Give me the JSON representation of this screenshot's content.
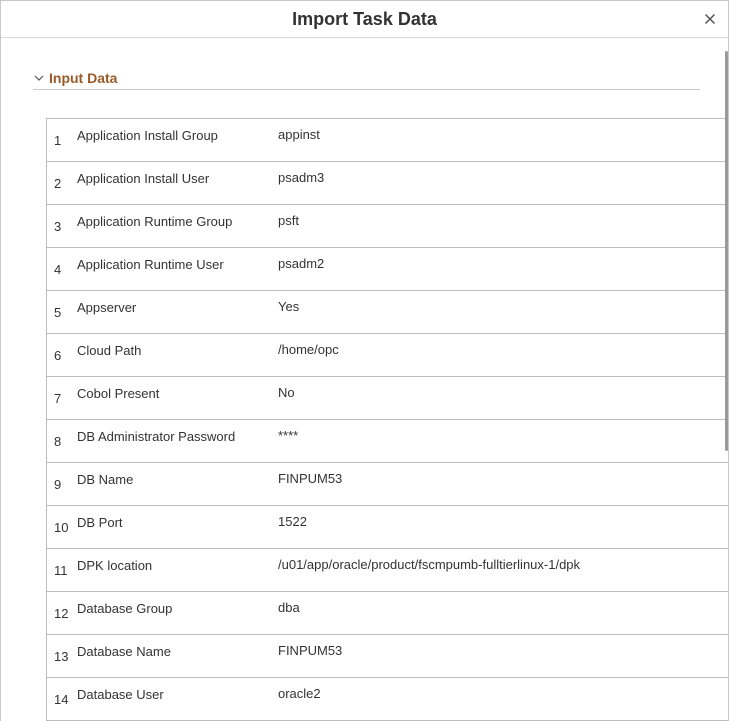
{
  "dialog": {
    "title": "Import Task Data",
    "close_icon": "close-icon"
  },
  "section": {
    "title": "Input Data",
    "expanded": true,
    "chevron_icon": "chevron-down-icon",
    "accent_color": "#9a5a27"
  },
  "rows": [
    {
      "num": "1",
      "key": "Application Install Group",
      "value": "appinst"
    },
    {
      "num": "2",
      "key": "Application Install User",
      "value": "psadm3"
    },
    {
      "num": "3",
      "key": "Application Runtime Group",
      "value": "psft"
    },
    {
      "num": "4",
      "key": "Application Runtime User",
      "value": "psadm2"
    },
    {
      "num": "5",
      "key": "Appserver",
      "value": "Yes"
    },
    {
      "num": "6",
      "key": "Cloud Path",
      "value": "/home/opc"
    },
    {
      "num": "7",
      "key": "Cobol Present",
      "value": "No"
    },
    {
      "num": "8",
      "key": "DB Administrator Password",
      "value": "****"
    },
    {
      "num": "9",
      "key": "DB Name",
      "value": "FINPUM53"
    },
    {
      "num": "10",
      "key": "DB Port",
      "value": "1522"
    },
    {
      "num": "11",
      "key": "DPK location",
      "value": "/u01/app/oracle/product/fscmpumb-fulltierlinux-1/dpk"
    },
    {
      "num": "12",
      "key": "Database Group",
      "value": "dba"
    },
    {
      "num": "13",
      "key": "Database Name",
      "value": "FINPUM53"
    },
    {
      "num": "14",
      "key": "Database User",
      "value": "oracle2"
    }
  ]
}
